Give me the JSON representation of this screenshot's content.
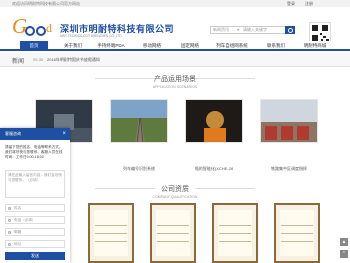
{
  "topbar": {
    "welcome": "欢迎访问明耐特科技有限公司官方网站",
    "login": "登录",
    "register": "注册"
  },
  "brand": {
    "logo_text": "Good",
    "name_cn": "深圳市明耐特科技有限公司",
    "name_en": "MNT TECHNOLOGY SHENZHEN CO.,LTD."
  },
  "search": {
    "category": "新闻资讯",
    "placeholder": "请输入关键字"
  },
  "nav": {
    "items": [
      "首页",
      "关于我们",
      "手持终端PDA",
      "移动网络",
      "固定网络",
      "列车自组网系统",
      "联系我们",
      "明耐特商城"
    ]
  },
  "news": {
    "label": "新闻",
    "date": "09-30",
    "text": "2016年明耐特国庆节放假通知"
  },
  "products": {
    "title_cn": "产品运用场景",
    "title_en": "APPLICATION SCENARIOS",
    "items": [
      "",
      "列车编号识别系统",
      "瓶的智能化(XCHE-28",
      "铁路集中区调度指挥"
    ]
  },
  "qualification": {
    "title_cn": "公司资质",
    "title_en": "COMPANY QUALIFICATION"
  },
  "chat": {
    "title": "客服咨询",
    "close": "×",
    "message": "请留下您的姓名、电话等联系方式，我们将尽快与您联系。客服人员在线时间：工作日9:00-18:00",
    "placeholder": "请在此输入留言内容，我们会尽快与您联系。（必填）",
    "fields": [
      "姓名",
      "电话（必填）",
      "邮箱",
      "地址"
    ],
    "send": "发送"
  },
  "colors": {
    "primary": "#1f4fa3",
    "accent": "#e8891a"
  }
}
